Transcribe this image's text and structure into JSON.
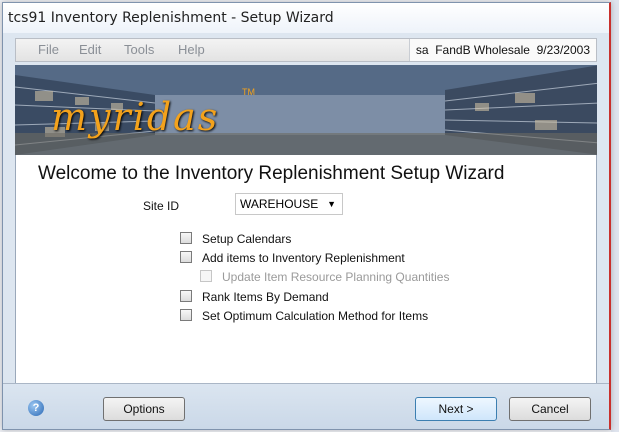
{
  "window": {
    "title": "tcs91 Inventory Replenishment - Setup Wizard"
  },
  "menu": {
    "items": [
      "File",
      "Edit",
      "Tools",
      "Help"
    ],
    "status": "sa  FandB Wholesale  9/23/2003"
  },
  "banner": {
    "logo_text": "myridas",
    "logo_tm": "TM"
  },
  "content": {
    "heading": "Welcome to the Inventory Replenishment Setup Wizard",
    "site_id_label": "Site ID",
    "site_id_value": "WAREHOUSE",
    "options": [
      {
        "label": "Setup Calendars",
        "checked": false,
        "enabled": true
      },
      {
        "label": "Add items to Inventory Replenishment",
        "checked": false,
        "enabled": true
      },
      {
        "label": "Update Item Resource Planning Quantities",
        "checked": false,
        "enabled": false
      },
      {
        "label": "Rank Items By Demand",
        "checked": false,
        "enabled": true
      },
      {
        "label": "Set Optimum Calculation Method for Items",
        "checked": false,
        "enabled": true
      }
    ]
  },
  "footer": {
    "help_glyph": "?",
    "options_label": "Options",
    "next_label": "Next >",
    "cancel_label": "Cancel"
  }
}
